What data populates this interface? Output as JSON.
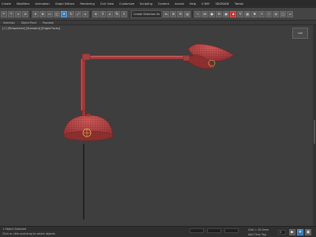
{
  "menu": {
    "items": [
      "Create",
      "Modifiers",
      "Animation",
      "Graph Editors",
      "Rendering",
      "Civil View",
      "Customize",
      "Scripting",
      "Content",
      "Arnold",
      "Help",
      "V-RAY",
      "3DGRADE",
      "Tweak"
    ]
  },
  "toolbar": {
    "selection_set": "Create Selection Se",
    "accent_color": "#3d79b8"
  },
  "ribbon": {
    "tabs": [
      "Selection",
      "Object Paint",
      "Populate"
    ]
  },
  "viewport": {
    "label": "[+] [Perspective] [Standard] [Edged Faces]",
    "viewcube_label": "TOP",
    "model_color": "#b84a4a",
    "wire_color": "#7a2222"
  },
  "status": {
    "selection_info": "1 Object Selected",
    "prompt": "Click or click-and-drag to select objects",
    "grid": "Grid = 10.0mm",
    "add_time_tag": "Add Time Tag",
    "frame": "0"
  }
}
